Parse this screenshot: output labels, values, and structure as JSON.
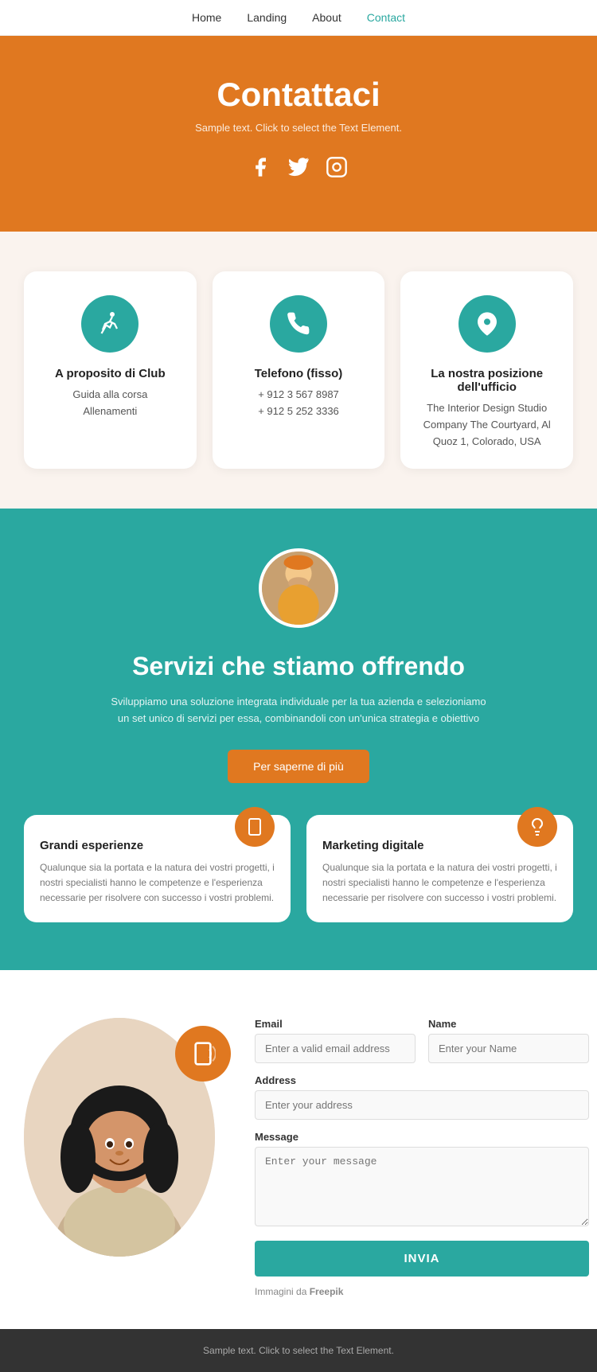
{
  "nav": {
    "items": [
      {
        "label": "Home",
        "active": false
      },
      {
        "label": "Landing",
        "active": false
      },
      {
        "label": "About",
        "active": false
      },
      {
        "label": "Contact",
        "active": true
      }
    ]
  },
  "hero": {
    "title": "Contattaci",
    "subtitle": "Sample text. Click to select the Text Element.",
    "icons": [
      "facebook",
      "twitter",
      "instagram"
    ]
  },
  "info_cards": [
    {
      "icon": "run",
      "title": "A proposito di Club",
      "lines": [
        "Guida alla corsa",
        "Allenamenti"
      ]
    },
    {
      "icon": "phone",
      "title": "Telefono (fisso)",
      "lines": [
        "+ 912 3 567 8987",
        "+ 912 5 252 3336"
      ]
    },
    {
      "icon": "location",
      "title": "La nostra posizione dell'ufficio",
      "lines": [
        "The Interior Design Studio Company The Courtyard, Al Quoz 1, Colorado, USA"
      ]
    }
  ],
  "teal_section": {
    "heading": "Servizi che stiamo offrendo",
    "subtitle": "Sviluppiamo una soluzione integrata individuale per la tua azienda e selezioniamo un set unico di servizi per essa, combinandoli con un'unica strategia e obiettivo",
    "button": "Per saperne di più",
    "cards": [
      {
        "title": "Grandi esperienze",
        "icon": "mobile",
        "text": "Qualunque sia la portata e la natura dei vostri progetti, i nostri specialisti hanno le competenze e l'esperienza necessarie per risolvere con successo i vostri problemi."
      },
      {
        "title": "Marketing digitale",
        "icon": "bulb",
        "text": "Qualunque sia la portata e la natura dei vostri progetti, i nostri specialisti hanno le competenze e l'esperienza necessarie per risolvere con successo i vostri problemi."
      }
    ]
  },
  "contact": {
    "email_label": "Email",
    "email_placeholder": "Enter a valid email address",
    "name_label": "Name",
    "name_placeholder": "Enter your Name",
    "address_label": "Address",
    "address_placeholder": "Enter your address",
    "message_label": "Message",
    "message_placeholder": "Enter your message",
    "submit": "INVIA",
    "attribution": "Immagini da",
    "attribution_link": "Freepik"
  },
  "footer": {
    "text": "Sample text. Click to select the Text Element."
  }
}
